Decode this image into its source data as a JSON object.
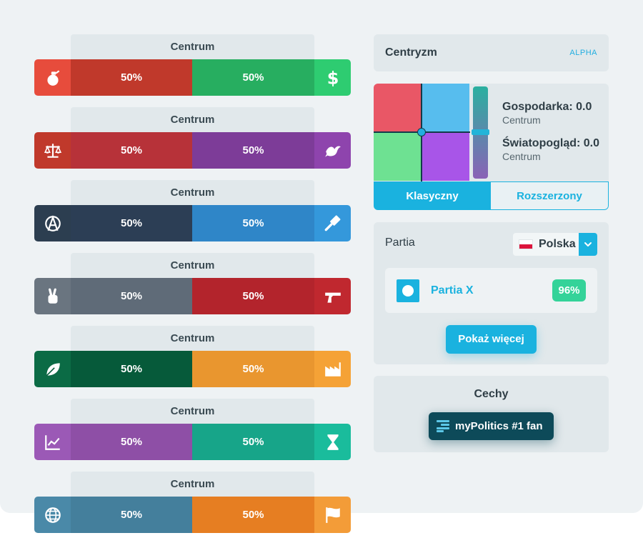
{
  "axes": [
    {
      "label": "Centrum",
      "left_icon": "grenade-icon",
      "right_icon": "dollar-icon",
      "left_value": "50%",
      "right_value": "50%",
      "colors": {
        "left_icon": "#e74c3c",
        "left": "#c0392b",
        "right": "#27ae60",
        "right_icon": "#2ecc71"
      }
    },
    {
      "label": "Centrum",
      "left_icon": "scales-icon",
      "right_icon": "dove-icon",
      "left_value": "50%",
      "right_value": "50%",
      "colors": {
        "left_icon": "#c0392b",
        "left": "#b73239",
        "right": "#7d3c98",
        "right_icon": "#8e44ad"
      }
    },
    {
      "label": "Centrum",
      "left_icon": "anarchy-icon",
      "right_icon": "gavel-icon",
      "left_value": "50%",
      "right_value": "50%",
      "colors": {
        "left_icon": "#2c3e50",
        "left": "#2c3e55",
        "right": "#2f86c8",
        "right_icon": "#3498db"
      }
    },
    {
      "label": "Centrum",
      "left_icon": "peace-hand-icon",
      "right_icon": "pistol-icon",
      "left_value": "50%",
      "right_value": "50%",
      "colors": {
        "left_icon": "#6a7580",
        "left": "#5f6b78",
        "right": "#b3242c",
        "right_icon": "#c0282f"
      }
    },
    {
      "label": "Centrum",
      "left_icon": "leaf-icon",
      "right_icon": "factory-icon",
      "left_value": "50%",
      "right_value": "50%",
      "colors": {
        "left_icon": "#0b6b45",
        "left": "#065a3a",
        "right": "#e9962f",
        "right_icon": "#f5a236"
      }
    },
    {
      "label": "Centrum",
      "left_icon": "growth-chart-icon",
      "right_icon": "hourglass-icon",
      "left_value": "50%",
      "right_value": "50%",
      "colors": {
        "left_icon": "#9b59b6",
        "left": "#8e4fa6",
        "right": "#17a589",
        "right_icon": "#1abc9c"
      }
    },
    {
      "label": "Centrum",
      "left_icon": "globe-icon",
      "right_icon": "flag-icon",
      "left_value": "50%",
      "right_value": "50%",
      "colors": {
        "left_icon": "#4a89a8",
        "left": "#447f9c",
        "right": "#e67e22",
        "right_icon": "#f39c38"
      }
    }
  ],
  "ideology": {
    "title": "Centryzm",
    "badge": "ALPHA"
  },
  "compass": {
    "quadrant_colors": {
      "top_left": "#e95766",
      "top_right": "#57bdee",
      "bottom_left": "#6ee192",
      "bottom_right": "#a855e8"
    },
    "economy_label": "Gospodarka: 0.0",
    "economy_desc": "Centrum",
    "worldview_label": "Światopogląd: 0.0",
    "worldview_desc": "Centrum",
    "tabs": [
      "Klasyczny",
      "Rozszerzony"
    ],
    "active_tab": 0
  },
  "party": {
    "label": "Partia",
    "country": "Polska",
    "results": [
      {
        "name": "Partia X",
        "match": "96%"
      }
    ],
    "more_button": "Pokaż więcej"
  },
  "traits": {
    "title": "Cechy",
    "badge": "myPolitics #1 fan"
  }
}
